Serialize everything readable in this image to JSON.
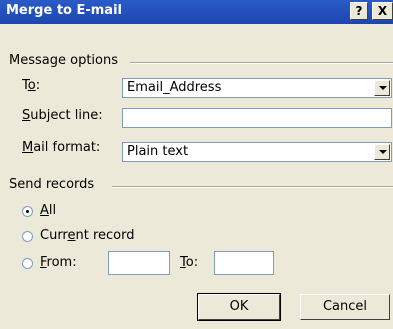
{
  "window": {
    "title": "Merge to E-mail",
    "help_label": "?",
    "close_label": "X"
  },
  "message_options": {
    "group_label": "Message options",
    "to_label": "To:",
    "to_value": "Email_Address",
    "subject_label": "Subject line:",
    "subject_value": "",
    "mail_format_label": "Mail format:",
    "mail_format_value": "Plain text"
  },
  "send_records": {
    "group_label": "Send records",
    "all_label": "All",
    "current_label": "Current record",
    "from_label": "From:",
    "to_label": "To:",
    "from_value": "",
    "to_value": "",
    "selected": "All"
  },
  "buttons": {
    "ok_label": "OK",
    "cancel_label": "Cancel"
  }
}
